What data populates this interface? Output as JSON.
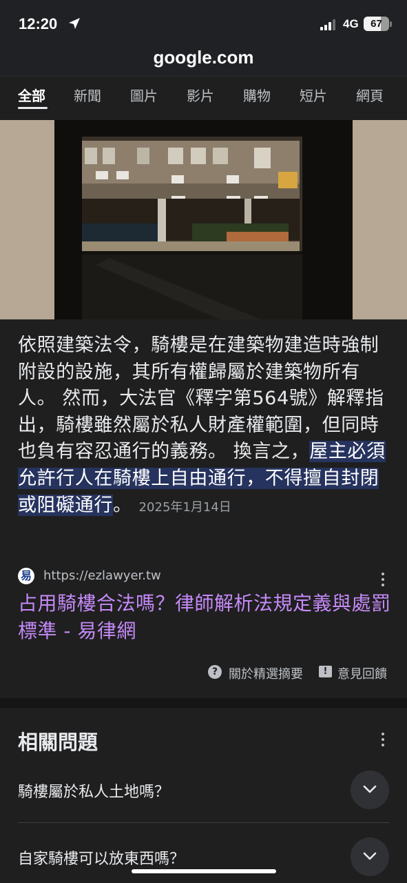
{
  "status_bar": {
    "time": "12:20",
    "network": "4G",
    "battery": "67",
    "battery_level": 0.67
  },
  "browser": {
    "url": "google.com"
  },
  "tabs": [
    {
      "label": "全部",
      "active": true
    },
    {
      "label": "新聞"
    },
    {
      "label": "圖片"
    },
    {
      "label": "影片"
    },
    {
      "label": "購物"
    },
    {
      "label": "短片"
    },
    {
      "label": "網頁"
    }
  ],
  "featured_snippet": {
    "text_plain": "依照建築法令，騎樓是在建築物建造時強制附設的設施，其所有權歸屬於建築物所有人。 然而，大法官《釋字第564號》解釋指出，騎樓雖然屬於私人財產權範圍，但同時也負有容忍通行的義務。 換言之，",
    "text_highlight": "屋主必須允許行人在騎樓上自由通行，不得擅自封閉或阻礙通行",
    "text_tail": "。",
    "date": "2025年1月14日",
    "highlight_color": "#26335e"
  },
  "source": {
    "icon_letter": "易",
    "url": "https://ezlawyer.tw",
    "title": "占用騎樓合法嗎？律師解析法規定義與處罰標準 - 易律網",
    "title_color": "#c58af9"
  },
  "snippet_footer": {
    "about": "關於精選摘要",
    "feedback": "意見回饋"
  },
  "related_questions": {
    "title": "相關問題",
    "items": [
      {
        "question": "騎樓屬於私人土地嗎？"
      },
      {
        "question": "自家騎樓可以放東西嗎？"
      }
    ]
  },
  "icons": {
    "location": "location-arrow-icon",
    "signal": "cell-signal-icon",
    "about": "question-circle-icon",
    "feedback": "feedback-icon",
    "expand": "chevron-down-icon",
    "more": "more-vert-icon"
  }
}
